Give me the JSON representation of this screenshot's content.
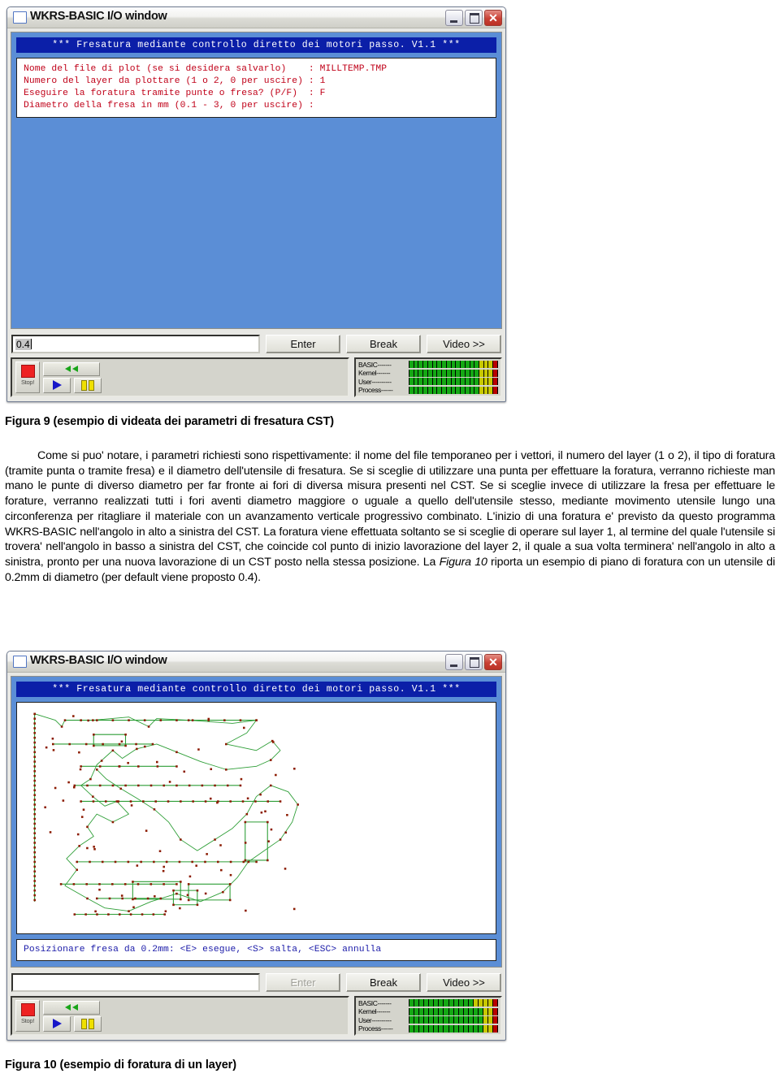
{
  "window1": {
    "title": "WKRS-BASIC I/O window",
    "titlebar_buttons": [
      {
        "name": "minimize",
        "label": "_"
      },
      {
        "name": "maximize",
        "label": "□"
      },
      {
        "name": "close",
        "label": "✕"
      }
    ],
    "console": {
      "header": "*** Fresatura mediante controllo diretto dei motori passo. V1.1 ***",
      "lines": [
        "Nome del file di plot (se si desidera salvarlo)    : MILLTEMP.TMP",
        "Numero del layer da plottare (1 o 2, 0 per uscire) : 1",
        "Eseguire la foratura tramite punte o fresa? (P/F)  : F",
        "Diametro della fresa in mm (0.1 - 3, 0 per uscire) :"
      ]
    },
    "io": {
      "input_value": "0.4",
      "input_selected": true,
      "enter_label": "Enter",
      "enter_disabled": false,
      "break_label": "Break",
      "video_label": "Video >>"
    },
    "controls": {
      "stop_label": "Stop!",
      "rewind_label": "rewind",
      "play_label": "play",
      "pause_label": "pause"
    },
    "meters": [
      {
        "label": "BASIC-------",
        "green": 15,
        "yellow": 3,
        "red": 1
      },
      {
        "label": "Kernel-------",
        "green": 15,
        "yellow": 3,
        "red": 1
      },
      {
        "label": "User----------",
        "green": 15,
        "yellow": 3,
        "red": 1
      },
      {
        "label": "Process------",
        "green": 15,
        "yellow": 3,
        "red": 1
      }
    ]
  },
  "figure9_caption": "Figura 9 (esempio di videata dei parametri di fresatura CST)",
  "body": {
    "p1_part1": "Come si puo' notare, i parametri richiesti sono rispettivamente: il nome del file temporaneo per i vettori, il numero del layer (1 o 2), il tipo di foratura (tramite punta o tramite fresa) e il diametro dell'utensile di fresatura. Se si sceglie di utilizzare una punta per effettuare la foratura, verranno richieste man mano le punte di diverso diametro per far fronte ai fori di diversa misura presenti nel CST. Se si sceglie invece di utilizzare la fresa per effettuare le forature, verranno realizzati tutti i fori aventi diametro maggiore o uguale a quello dell'utensile stesso, mediante movimento utensile lungo una circonferenza per ritagliare il materiale con un avanzamento verticale progressivo combinato. L'inizio di una foratura e' previsto da questo programma WKRS-BASIC nell'angolo in alto a sinistra del CST. La foratura viene effettuata soltanto se si sceglie di operare sul layer 1, al termine del quale l'utensile si trovera' nell'angolo in basso a sinistra del CST, che coincide col punto di inizio lavorazione del layer 2, il quale a sua volta terminera' nell'angolo in alto a sinistra, pronto per una nuova lavorazione di un CST posto nella stessa posizione. La ",
    "p1_italic": "Figura 10",
    "p1_part2": " riporta un esempio di piano di foratura con un utensile di 0.2mm di diametro (per default viene proposto 0.4)."
  },
  "window2": {
    "title": "WKRS-BASIC I/O window",
    "console": {
      "header": "*** Fresatura mediante controllo diretto dei motori passo. V1.1 ***",
      "status": "Posizionare fresa da 0.2mm: <E> esegue, <S> salta, <ESC> annulla"
    },
    "io": {
      "input_value": "",
      "enter_label": "Enter",
      "enter_disabled": true,
      "break_label": "Break",
      "video_label": "Video >>"
    },
    "controls": {
      "stop_label": "Stop!"
    },
    "meters": [
      {
        "label": "BASIC-------",
        "green": 13,
        "yellow": 4,
        "red": 1
      },
      {
        "label": "Kernel-------",
        "green": 15,
        "yellow": 2,
        "red": 1
      },
      {
        "label": "User----------",
        "green": 15,
        "yellow": 2,
        "red": 1
      },
      {
        "label": "Process------",
        "green": 15,
        "yellow": 2,
        "red": 1
      }
    ],
    "plot": {
      "path_color": "#2d9e36",
      "point_color": "#8b1a00",
      "background": "#ffffff",
      "description": "toolpath di foratura layer"
    }
  },
  "figure10_caption": "Figura 10 (esempio di foratura di un layer)",
  "colors": {
    "console_blue": "#5b8ed6",
    "console_title_blue": "#0b1fa8",
    "console_text_red": "#c00018",
    "console_status_blue": "#1a1aa8",
    "chrome_gray": "#d4d4cc"
  }
}
